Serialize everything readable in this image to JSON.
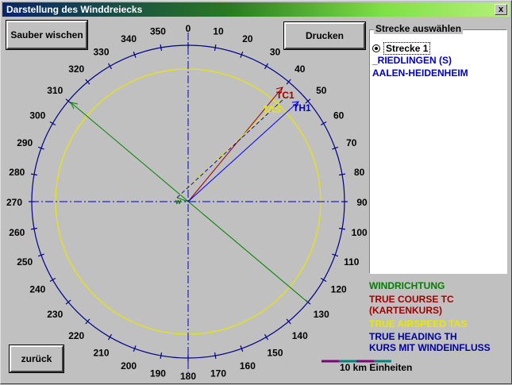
{
  "window": {
    "title": "Darstellung des Winddreiecks",
    "close_glyph": "x"
  },
  "buttons": {
    "clear": "Sauber wischen",
    "print": "Drucken",
    "back": "zurück"
  },
  "route_panel": {
    "title": "Strecke auswählen",
    "radio_label": "Strecke 1",
    "routes": [
      "_RIEDLINGEN (S)",
      "AALEN-HEIDENHEIM"
    ]
  },
  "compass": {
    "bearing_labels": [
      "0",
      "10",
      "20",
      "30",
      "40",
      "50",
      "60",
      "70",
      "80",
      "90",
      "100",
      "110",
      "120",
      "130",
      "140",
      "150",
      "160",
      "170",
      "180",
      "190",
      "200",
      "210",
      "220",
      "230",
      "240",
      "250",
      "260",
      "270",
      "280",
      "290",
      "300",
      "310",
      "320",
      "330",
      "340",
      "350"
    ]
  },
  "vectors": {
    "tc_label": "TC1",
    "tas_label": "TAS",
    "th_label": "TH1",
    "w_label": "w"
  },
  "legend": {
    "wind": "WINDRICHTUNG",
    "tc_line1": "TRUE COURSE TC",
    "tc_line2": "(KARTENKURS)",
    "tas": "TRUE AIRSPEED  TAS",
    "th_line1": "TRUE HEADING  TH",
    "th_line2": "KURS MIT WINDEINFLUSS"
  },
  "scale": {
    "label": "10 km Einheiten"
  },
  "colors": {
    "compass": "#00008b",
    "axes": "#0000c0",
    "wind": "#008000",
    "tc": "#a00000",
    "tas": "#e8e800",
    "th": "#0000ff",
    "scale_magenta": "#800080",
    "scale_teal": "#008080"
  }
}
